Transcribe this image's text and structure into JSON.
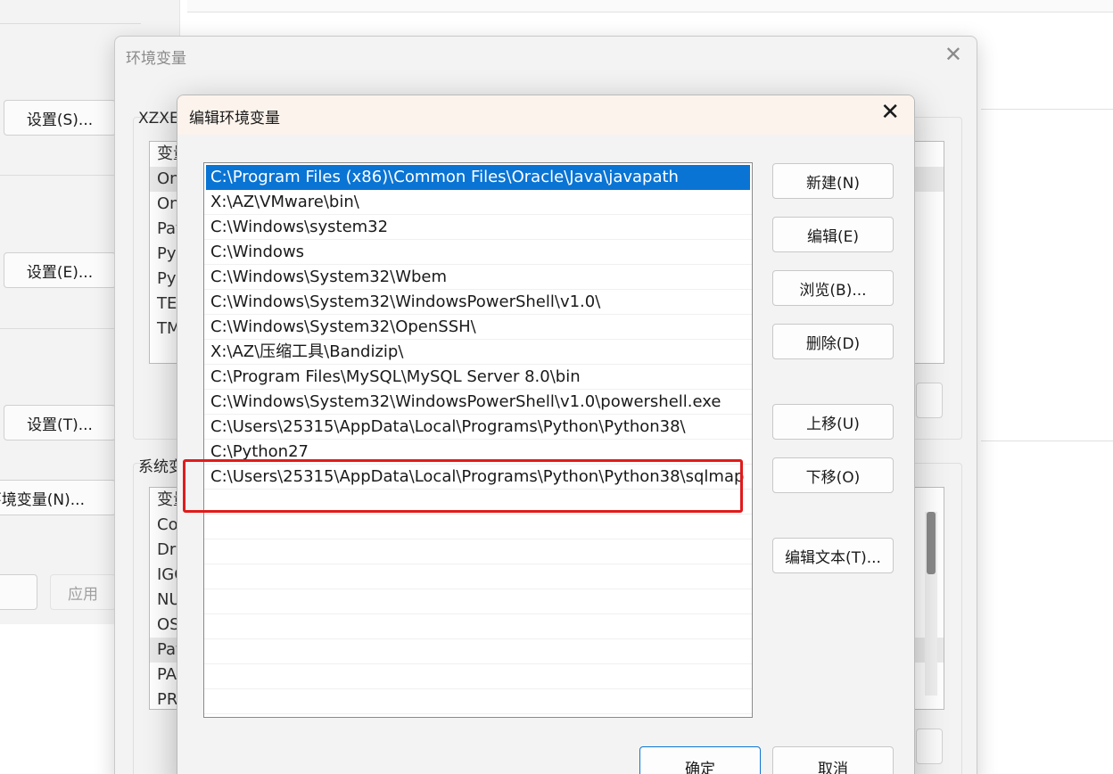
{
  "system_properties": {
    "buttons": {
      "settings_s": "设置(S)...",
      "settings_e": "设置(E)...",
      "settings_t": "设置(T)...",
      "env_vars": "环境变量(N)...",
      "apply": "应用"
    }
  },
  "env_window": {
    "title": "环境变量",
    "user_section_label": "XZXE",
    "system_section_label": "系统变",
    "user_vars": [
      "变量",
      "On",
      "On",
      "Pat",
      "Py",
      "Py",
      "TEI",
      "TM"
    ],
    "system_vars": [
      "变量",
      "Co",
      "Dri",
      "IGC",
      "NU",
      "OS",
      "Pat",
      "PA",
      "PR"
    ]
  },
  "edit_dialog": {
    "title": "编辑环境变量",
    "paths": [
      "C:\\Program Files (x86)\\Common Files\\Oracle\\Java\\javapath",
      "X:\\AZ\\VMware\\bin\\",
      "C:\\Windows\\system32",
      "C:\\Windows",
      "C:\\Windows\\System32\\Wbem",
      "C:\\Windows\\System32\\WindowsPowerShell\\v1.0\\",
      "C:\\Windows\\System32\\OpenSSH\\",
      "X:\\AZ\\压缩工具\\Bandizip\\",
      "C:\\Program Files\\MySQL\\MySQL Server 8.0\\bin",
      "C:\\Windows\\System32\\WindowsPowerShell\\v1.0\\powershell.exe",
      "C:\\Users\\25315\\AppData\\Local\\Programs\\Python\\Python38\\",
      "C:\\Python27",
      "C:\\Users\\25315\\AppData\\Local\\Programs\\Python\\Python38\\sqlmap"
    ],
    "buttons": {
      "new": "新建(N)",
      "edit": "编辑(E)",
      "browse": "浏览(B)...",
      "delete": "删除(D)",
      "move_up": "上移(U)",
      "move_down": "下移(O)",
      "edit_text": "编辑文本(T)...",
      "ok": "确定",
      "cancel": "取消"
    },
    "highlight_color": "#e11b1b",
    "selection_color": "#0a74d4"
  }
}
